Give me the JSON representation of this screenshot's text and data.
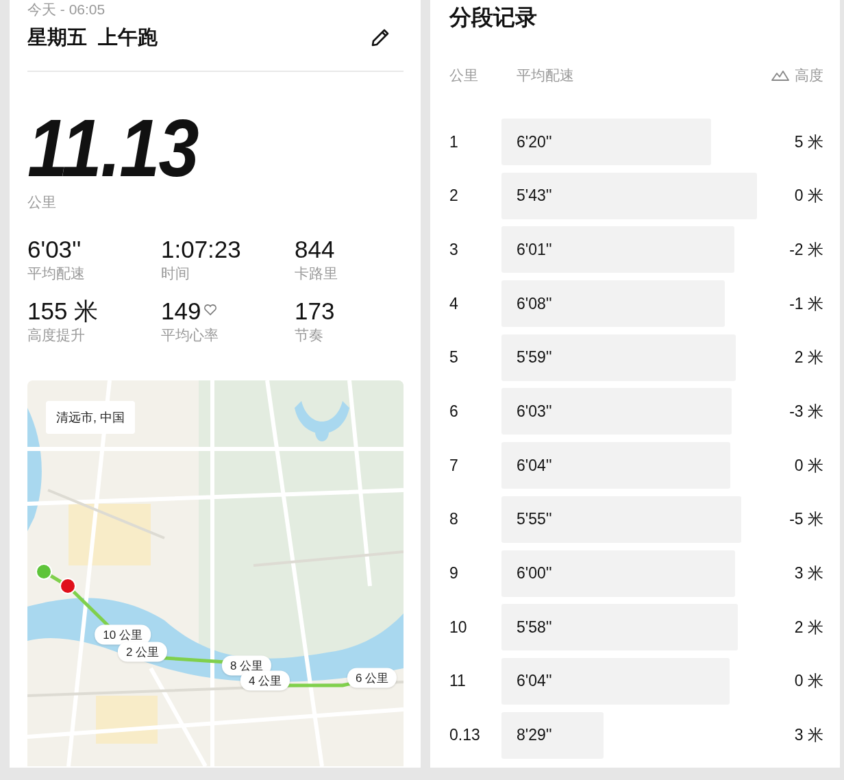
{
  "activity": {
    "date": "今天 - 06:05",
    "title": "星期五  上午跑",
    "distance": "11.13",
    "distance_unit": "公里"
  },
  "stats": [
    {
      "value": "6'03''",
      "label": "平均配速",
      "kind": "plain"
    },
    {
      "value": "1:07:23",
      "label": "时间",
      "kind": "plain"
    },
    {
      "value": "844",
      "label": "卡路里",
      "kind": "plain"
    },
    {
      "value": "155 米",
      "label": "高度提升",
      "kind": "plain"
    },
    {
      "value": "149",
      "label": "平均心率",
      "kind": "heart"
    },
    {
      "value": "173",
      "label": "节奏",
      "kind": "plain"
    }
  ],
  "map": {
    "location": "清远市, 中国",
    "markers": [
      {
        "label": "10 公里"
      },
      {
        "label": "2 公里"
      },
      {
        "label": "8 公里"
      },
      {
        "label": "4 公里"
      },
      {
        "label": "6 公里"
      }
    ]
  },
  "splits": {
    "title": "分段记录",
    "columns": [
      "公里",
      "平均配速",
      "高度"
    ],
    "rows": [
      {
        "km": "1",
        "pace": "6'20''",
        "elevation": "5 米"
      },
      {
        "km": "2",
        "pace": "5'43''",
        "elevation": "0 米"
      },
      {
        "km": "3",
        "pace": "6'01''",
        "elevation": "-2 米"
      },
      {
        "km": "4",
        "pace": "6'08''",
        "elevation": "-1 米"
      },
      {
        "km": "5",
        "pace": "5'59''",
        "elevation": "2 米"
      },
      {
        "km": "6",
        "pace": "6'03''",
        "elevation": "-3 米"
      },
      {
        "km": "7",
        "pace": "6'04''",
        "elevation": "0 米"
      },
      {
        "km": "8",
        "pace": "5'55''",
        "elevation": "-5 米"
      },
      {
        "km": "9",
        "pace": "6'00''",
        "elevation": "3 米"
      },
      {
        "km": "10",
        "pace": "5'58''",
        "elevation": "2 米"
      },
      {
        "km": "11",
        "pace": "6'04''",
        "elevation": "0 米"
      },
      {
        "km": "0.13",
        "pace": "8'29''",
        "elevation": "3 米"
      }
    ]
  }
}
